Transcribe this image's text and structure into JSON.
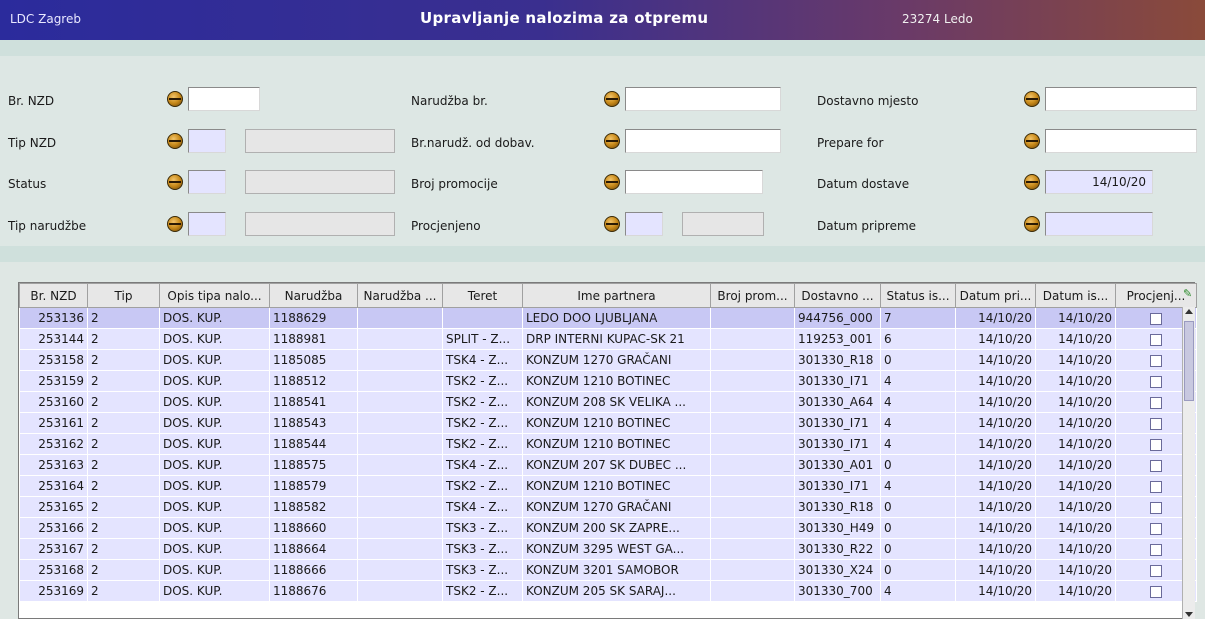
{
  "title_bar": {
    "location": "LDC Zagreb",
    "title": "Upravljanje nalozima za otpremu",
    "user": "23274 Ledo"
  },
  "form": {
    "col1": {
      "br_nzd_label": "Br. NZD",
      "tip_nzd_label": "Tip NZD",
      "status_label": "Status",
      "tip_narudzbe_label": "Tip narudžbe"
    },
    "col2": {
      "narudzba_br_label": "Narudžba br.",
      "br_narudz_od_dobav_label": "Br.narudž. od dobav.",
      "broj_promocije_label": "Broj promocije",
      "procjenjeno_label": "Procjenjeno"
    },
    "col3": {
      "dostavno_mjesto_label": "Dostavno mjesto",
      "prepare_for_label": "Prepare for",
      "datum_dostave_label": "Datum dostave",
      "datum_dostave_value": "14/10/20",
      "datum_pripreme_label": "Datum pripreme"
    }
  },
  "table": {
    "columns": [
      "Br. NZD",
      "Tip",
      "Opis tipa nalo...",
      "Narudžba",
      "Narudžba ...",
      "Teret",
      "Ime partnera",
      "Broj prom...",
      "Dostavno ...",
      "Status is...",
      "Datum pri...",
      "Datum is...",
      "Procjenj..."
    ],
    "rows": [
      [
        "253136",
        "2",
        "DOS. KUP.",
        "1188629",
        "",
        "",
        "LEDO DOO LJUBLJANA",
        "",
        "944756_000",
        "7",
        "14/10/20",
        "14/10/20"
      ],
      [
        "253144",
        "2",
        "DOS. KUP.",
        "1188981",
        "",
        "SPLIT - Z...",
        "DRP INTERNI KUPAC-SK 21",
        "",
        "119253_001",
        "6",
        "14/10/20",
        "14/10/20"
      ],
      [
        "253158",
        "2",
        "DOS. KUP.",
        "1185085",
        "",
        "TSK4 - Z...",
        "KONZUM 1270 GRAČANI",
        "",
        "301330_R18",
        "0",
        "14/10/20",
        "14/10/20"
      ],
      [
        "253159",
        "2",
        "DOS. KUP.",
        "1188512",
        "",
        "TSK2 - Z...",
        "KONZUM 1210 BOTINEC",
        "",
        "301330_I71",
        "4",
        "14/10/20",
        "14/10/20"
      ],
      [
        "253160",
        "2",
        "DOS. KUP.",
        "1188541",
        "",
        "TSK2 - Z...",
        "KONZUM 208 SK VELIKA ...",
        "",
        "301330_A64",
        "4",
        "14/10/20",
        "14/10/20"
      ],
      [
        "253161",
        "2",
        "DOS. KUP.",
        "1188543",
        "",
        "TSK2 - Z...",
        "KONZUM 1210 BOTINEC",
        "",
        "301330_I71",
        "4",
        "14/10/20",
        "14/10/20"
      ],
      [
        "253162",
        "2",
        "DOS. KUP.",
        "1188544",
        "",
        "TSK2 - Z...",
        "KONZUM 1210 BOTINEC",
        "",
        "301330_I71",
        "4",
        "14/10/20",
        "14/10/20"
      ],
      [
        "253163",
        "2",
        "DOS. KUP.",
        "1188575",
        "",
        "TSK4 - Z...",
        "KONZUM 207 SK DUBEC ...",
        "",
        "301330_A01",
        "0",
        "14/10/20",
        "14/10/20"
      ],
      [
        "253164",
        "2",
        "DOS. KUP.",
        "1188579",
        "",
        "TSK2 - Z...",
        "KONZUM 1210 BOTINEC",
        "",
        "301330_I71",
        "4",
        "14/10/20",
        "14/10/20"
      ],
      [
        "253165",
        "2",
        "DOS. KUP.",
        "1188582",
        "",
        "TSK4 - Z...",
        "KONZUM 1270 GRAČANI",
        "",
        "301330_R18",
        "0",
        "14/10/20",
        "14/10/20"
      ],
      [
        "253166",
        "2",
        "DOS. KUP.",
        "1188660",
        "",
        "TSK3 - Z...",
        "KONZUM 200 SK ZAPRE...",
        "",
        "301330_H49",
        "0",
        "14/10/20",
        "14/10/20"
      ],
      [
        "253167",
        "2",
        "DOS. KUP.",
        "1188664",
        "",
        "TSK3 - Z...",
        "KONZUM 3295 WEST GA...",
        "",
        "301330_R22",
        "0",
        "14/10/20",
        "14/10/20"
      ],
      [
        "253168",
        "2",
        "DOS. KUP.",
        "1188666",
        "",
        "TSK3 - Z...",
        "KONZUM 3201 SAMOBOR",
        "",
        "301330_X24",
        "0",
        "14/10/20",
        "14/10/20"
      ],
      [
        "253169",
        "2",
        "DOS. KUP.",
        "1188676",
        "",
        "TSK2 - Z...",
        "KONZUM 205 SK SARAJ...",
        "",
        "301330_700",
        "4",
        "14/10/20",
        "14/10/20"
      ]
    ]
  },
  "colors": {
    "title_gradient_start": "#2b2b9c",
    "title_gradient_end": "#8a4a3a",
    "row_bg": "#e4e4ff",
    "row_selected_bg": "#c8c8f4",
    "form_bg": "#dde7e4"
  },
  "icons": {
    "field_lookup": "lookup-dot-icon",
    "grid_corner": "column-chooser-icon"
  }
}
